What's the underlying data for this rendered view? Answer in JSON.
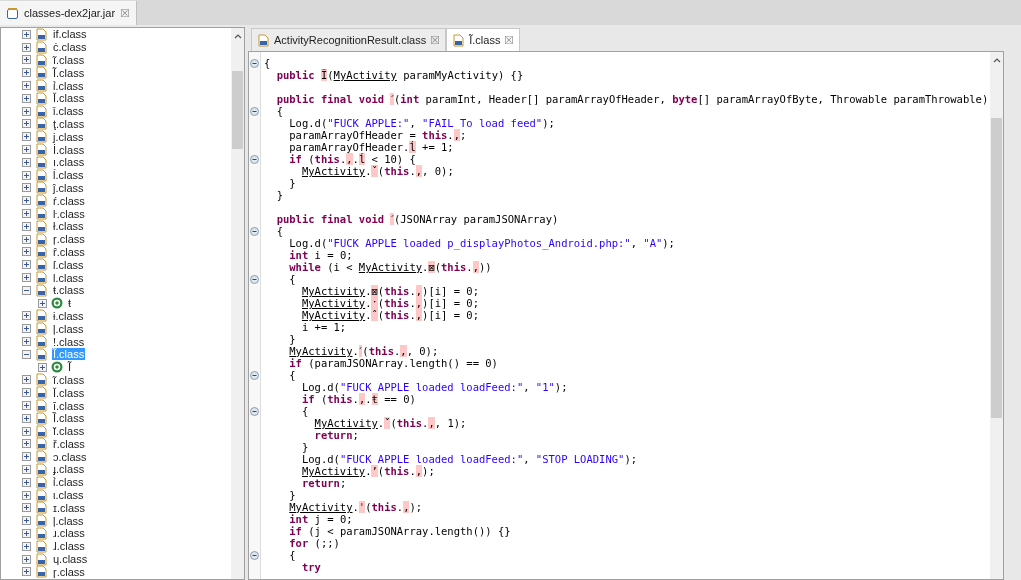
{
  "top_tab": {
    "label": "classes-dex2jar.jar",
    "close": "☒"
  },
  "tree": [
    {
      "name": "if.class",
      "expanded": false,
      "selected": false
    },
    {
      "name": "ċ.class",
      "expanded": false,
      "selected": false
    },
    {
      "name": "ĩ.class",
      "expanded": false,
      "selected": false
    },
    {
      "name": "Ĩ.class",
      "expanded": false,
      "selected": false
    },
    {
      "name": "ỉ.class",
      "expanded": false,
      "selected": false
    },
    {
      "name": "Ĭ.class",
      "expanded": false,
      "selected": false
    },
    {
      "name": "ǐ.class",
      "expanded": false,
      "selected": false
    },
    {
      "name": "ţ.class",
      "expanded": false,
      "selected": false
    },
    {
      "name": "j.class",
      "expanded": false,
      "selected": false
    },
    {
      "name": "İ.class",
      "expanded": false,
      "selected": false
    },
    {
      "name": "ı.class",
      "expanded": false,
      "selected": false
    },
    {
      "name": "ĺ.class",
      "expanded": false,
      "selected": false
    },
    {
      "name": "ĵ.class",
      "expanded": false,
      "selected": false
    },
    {
      "name": "ŕ.class",
      "expanded": false,
      "selected": false
    },
    {
      "name": "ŀ.class",
      "expanded": false,
      "selected": false
    },
    {
      "name": "ł.class",
      "expanded": false,
      "selected": false
    },
    {
      "name": "ŗ.class",
      "expanded": false,
      "selected": false
    },
    {
      "name": "ȓ.class",
      "expanded": false,
      "selected": false
    },
    {
      "name": "ſ.class",
      "expanded": false,
      "selected": false
    },
    {
      "name": "l.class",
      "expanded": false,
      "selected": false
    },
    {
      "name": "ŧ.class",
      "expanded": true,
      "selected": false,
      "children": [
        {
          "name": "ŧ",
          "expanded": false,
          "selected": false
        }
      ]
    },
    {
      "name": "ɨ.class",
      "expanded": false,
      "selected": false
    },
    {
      "name": "ļ.class",
      "expanded": false,
      "selected": false
    },
    {
      "name": "ǃ.class",
      "expanded": false,
      "selected": false
    },
    {
      "name": "Ĩ.class",
      "expanded": true,
      "selected": true,
      "children": [
        {
          "name": "Ĩ",
          "expanded": false,
          "selected": false
        }
      ]
    },
    {
      "name": "ĩ.class",
      "expanded": false,
      "selected": false
    },
    {
      "name": "Ĭ.class",
      "expanded": false,
      "selected": false
    },
    {
      "name": "ī.class",
      "expanded": false,
      "selected": false
    },
    {
      "name": "Ȉ.class",
      "expanded": false,
      "selected": false
    },
    {
      "name": "ĭ.class",
      "expanded": false,
      "selected": false
    },
    {
      "name": "ř.class",
      "expanded": false,
      "selected": false
    },
    {
      "name": "ↄ.class",
      "expanded": false,
      "selected": false
    },
    {
      "name": "ɟ.class",
      "expanded": false,
      "selected": false
    },
    {
      "name": "ỉ.class",
      "expanded": false,
      "selected": false
    },
    {
      "name": "ι.class",
      "expanded": false,
      "selected": false
    },
    {
      "name": "ɪ.class",
      "expanded": false,
      "selected": false
    },
    {
      "name": "ļ.class",
      "expanded": false,
      "selected": false
    },
    {
      "name": "ɹ.class",
      "expanded": false,
      "selected": false
    },
    {
      "name": "ɺ.class",
      "expanded": false,
      "selected": false
    },
    {
      "name": "ɥ.class",
      "expanded": false,
      "selected": false
    },
    {
      "name": "ɼ.class",
      "expanded": false,
      "selected": false
    }
  ],
  "editor_tabs": [
    {
      "label": "ActivityRecognitionResult.class",
      "close": "☒",
      "selected": false
    },
    {
      "label": "Ĩ.class",
      "close": "☒",
      "selected": true
    }
  ],
  "code_lines": [
    {
      "kind": "code",
      "foldable": true,
      "segments": [
        {
          "kind": "plain",
          "text": "{"
        }
      ]
    },
    {
      "kind": "code",
      "foldable": false,
      "segments": [
        {
          "kind": "kw",
          "text": "  public "
        },
        {
          "kind": "hl",
          "text": "Ĩ"
        },
        {
          "kind": "plain",
          "text": "("
        },
        {
          "kind": "link",
          "text": "MyActivity"
        },
        {
          "kind": "plain",
          "text": " paramMyActivity) {}"
        }
      ]
    },
    {
      "kind": "blank"
    },
    {
      "kind": "code",
      "foldable": false,
      "segments": [
        {
          "kind": "kw",
          "text": "  public final void "
        },
        {
          "kind": "hl",
          "text": "ˊ"
        },
        {
          "kind": "plain",
          "text": "("
        },
        {
          "kind": "kw",
          "text": "int"
        },
        {
          "kind": "plain",
          "text": " paramInt, Header[] paramArrayOfHeader, "
        },
        {
          "kind": "kw",
          "text": "byte"
        },
        {
          "kind": "plain",
          "text": "[] paramArrayOfByte, Throwable paramThrowable)"
        }
      ]
    },
    {
      "kind": "code",
      "foldable": true,
      "segments": [
        {
          "kind": "plain",
          "text": "  {"
        }
      ]
    },
    {
      "kind": "code",
      "foldable": false,
      "segments": [
        {
          "kind": "plain",
          "text": "    Log.d("
        },
        {
          "kind": "str",
          "text": "\"FUCK APPLE:\""
        },
        {
          "kind": "plain",
          "text": ", "
        },
        {
          "kind": "str",
          "text": "\"FAIL To load feed\""
        },
        {
          "kind": "plain",
          "text": ");"
        }
      ]
    },
    {
      "kind": "code",
      "foldable": false,
      "segments": [
        {
          "kind": "plain",
          "text": "    paramArrayOfHeader = "
        },
        {
          "kind": "kw",
          "text": "this"
        },
        {
          "kind": "plain",
          "text": "."
        },
        {
          "kind": "hl",
          "text": "‚"
        },
        {
          "kind": "plain",
          "text": ";"
        }
      ]
    },
    {
      "kind": "code",
      "foldable": false,
      "segments": [
        {
          "kind": "plain",
          "text": "    paramArrayOfHeader."
        },
        {
          "kind": "hl",
          "text": "ĺ"
        },
        {
          "kind": "plain",
          "text": " += 1;"
        }
      ]
    },
    {
      "kind": "code",
      "foldable": true,
      "segments": [
        {
          "kind": "kw",
          "text": "    if"
        },
        {
          "kind": "plain",
          "text": " ("
        },
        {
          "kind": "kw",
          "text": "this"
        },
        {
          "kind": "plain",
          "text": "."
        },
        {
          "kind": "hl",
          "text": "‚"
        },
        {
          "kind": "plain",
          "text": "."
        },
        {
          "kind": "hl",
          "text": "ĺ"
        },
        {
          "kind": "plain",
          "text": " < 10) {"
        }
      ]
    },
    {
      "kind": "code",
      "foldable": false,
      "segments": [
        {
          "kind": "link",
          "text": "      MyActivity"
        },
        {
          "kind": "plain",
          "text": "."
        },
        {
          "kind": "hl",
          "text": "ˇ"
        },
        {
          "kind": "plain",
          "text": "("
        },
        {
          "kind": "kw",
          "text": "this"
        },
        {
          "kind": "plain",
          "text": "."
        },
        {
          "kind": "hl",
          "text": "‚"
        },
        {
          "kind": "plain",
          "text": ", 0);"
        }
      ]
    },
    {
      "kind": "code",
      "foldable": false,
      "segments": [
        {
          "kind": "plain",
          "text": "    }"
        }
      ]
    },
    {
      "kind": "code",
      "foldable": false,
      "segments": [
        {
          "kind": "plain",
          "text": "  }"
        }
      ]
    },
    {
      "kind": "blank"
    },
    {
      "kind": "code",
      "foldable": false,
      "segments": [
        {
          "kind": "kw",
          "text": "  public final void "
        },
        {
          "kind": "hl",
          "text": "ˊ"
        },
        {
          "kind": "plain",
          "text": "(JSONArray paramJSONArray)"
        }
      ]
    },
    {
      "kind": "code",
      "foldable": true,
      "segments": [
        {
          "kind": "plain",
          "text": "  {"
        }
      ]
    },
    {
      "kind": "code",
      "foldable": false,
      "segments": [
        {
          "kind": "plain",
          "text": "    Log.d("
        },
        {
          "kind": "str",
          "text": "\"FUCK APPLE loaded p_displayPhotos_Android.php:\""
        },
        {
          "kind": "plain",
          "text": ", "
        },
        {
          "kind": "str",
          "text": "\"A\""
        },
        {
          "kind": "plain",
          "text": ");"
        }
      ]
    },
    {
      "kind": "code",
      "foldable": false,
      "segments": [
        {
          "kind": "kw",
          "text": "    int"
        },
        {
          "kind": "plain",
          "text": " i = 0;"
        }
      ]
    },
    {
      "kind": "code",
      "foldable": false,
      "segments": [
        {
          "kind": "kw",
          "text": "    while"
        },
        {
          "kind": "plain",
          "text": " (i < "
        },
        {
          "kind": "link",
          "text": "MyActivity"
        },
        {
          "kind": "plain",
          "text": "."
        },
        {
          "kind": "hl",
          "text": "⊠"
        },
        {
          "kind": "plain",
          "text": "("
        },
        {
          "kind": "kw",
          "text": "this"
        },
        {
          "kind": "plain",
          "text": "."
        },
        {
          "kind": "hl",
          "text": "‚"
        },
        {
          "kind": "plain",
          "text": "))"
        }
      ]
    },
    {
      "kind": "code",
      "foldable": true,
      "segments": [
        {
          "kind": "plain",
          "text": "    {"
        }
      ]
    },
    {
      "kind": "code",
      "foldable": false,
      "segments": [
        {
          "kind": "link",
          "text": "      MyActivity"
        },
        {
          "kind": "plain",
          "text": "."
        },
        {
          "kind": "hl",
          "text": "⊠"
        },
        {
          "kind": "plain",
          "text": "("
        },
        {
          "kind": "kw",
          "text": "this"
        },
        {
          "kind": "plain",
          "text": "."
        },
        {
          "kind": "hl",
          "text": "‚"
        },
        {
          "kind": "plain",
          "text": ")[i] = 0;"
        }
      ]
    },
    {
      "kind": "code",
      "foldable": false,
      "segments": [
        {
          "kind": "link",
          "text": "      MyActivity"
        },
        {
          "kind": "plain",
          "text": "."
        },
        {
          "kind": "hl",
          "text": "ˑ"
        },
        {
          "kind": "plain",
          "text": "("
        },
        {
          "kind": "kw",
          "text": "this"
        },
        {
          "kind": "plain",
          "text": "."
        },
        {
          "kind": "hl",
          "text": "‚"
        },
        {
          "kind": "plain",
          "text": ")[i] = 0;"
        }
      ]
    },
    {
      "kind": "code",
      "foldable": false,
      "segments": [
        {
          "kind": "link",
          "text": "      MyActivity"
        },
        {
          "kind": "plain",
          "text": "."
        },
        {
          "kind": "hl",
          "text": "ˆ"
        },
        {
          "kind": "plain",
          "text": "("
        },
        {
          "kind": "kw",
          "text": "this"
        },
        {
          "kind": "plain",
          "text": "."
        },
        {
          "kind": "hl",
          "text": "‚"
        },
        {
          "kind": "plain",
          "text": ")[i] = 0;"
        }
      ]
    },
    {
      "kind": "code",
      "foldable": false,
      "segments": [
        {
          "kind": "plain",
          "text": "      i += 1;"
        }
      ]
    },
    {
      "kind": "code",
      "foldable": false,
      "segments": [
        {
          "kind": "plain",
          "text": "    }"
        }
      ]
    },
    {
      "kind": "code",
      "foldable": false,
      "segments": [
        {
          "kind": "link",
          "text": "    MyActivity"
        },
        {
          "kind": "plain",
          "text": "."
        },
        {
          "kind": "hl",
          "text": "ˊ"
        },
        {
          "kind": "plain",
          "text": "("
        },
        {
          "kind": "kw",
          "text": "this"
        },
        {
          "kind": "plain",
          "text": "."
        },
        {
          "kind": "hl",
          "text": "‚"
        },
        {
          "kind": "plain",
          "text": ", 0);"
        }
      ]
    },
    {
      "kind": "code",
      "foldable": false,
      "segments": [
        {
          "kind": "kw",
          "text": "    if"
        },
        {
          "kind": "plain",
          "text": " (paramJSONArray.length() == 0)"
        }
      ]
    },
    {
      "kind": "code",
      "foldable": true,
      "segments": [
        {
          "kind": "plain",
          "text": "    {"
        }
      ]
    },
    {
      "kind": "code",
      "foldable": false,
      "segments": [
        {
          "kind": "plain",
          "text": "      Log.d("
        },
        {
          "kind": "str",
          "text": "\"FUCK APPLE loaded loadFeed:\""
        },
        {
          "kind": "plain",
          "text": ", "
        },
        {
          "kind": "str",
          "text": "\"1\""
        },
        {
          "kind": "plain",
          "text": ");"
        }
      ]
    },
    {
      "kind": "code",
      "foldable": false,
      "segments": [
        {
          "kind": "kw",
          "text": "      if"
        },
        {
          "kind": "plain",
          "text": " ("
        },
        {
          "kind": "kw",
          "text": "this"
        },
        {
          "kind": "plain",
          "text": "."
        },
        {
          "kind": "hl",
          "text": "‚"
        },
        {
          "kind": "plain",
          "text": "."
        },
        {
          "kind": "hl",
          "text": "ŧ"
        },
        {
          "kind": "plain",
          "text": " == 0)"
        }
      ]
    },
    {
      "kind": "code",
      "foldable": true,
      "segments": [
        {
          "kind": "plain",
          "text": "      {"
        }
      ]
    },
    {
      "kind": "code",
      "foldable": false,
      "segments": [
        {
          "kind": "link",
          "text": "        MyActivity"
        },
        {
          "kind": "plain",
          "text": "."
        },
        {
          "kind": "hl",
          "text": "ˇ"
        },
        {
          "kind": "plain",
          "text": "("
        },
        {
          "kind": "kw",
          "text": "this"
        },
        {
          "kind": "plain",
          "text": "."
        },
        {
          "kind": "hl",
          "text": "‚"
        },
        {
          "kind": "plain",
          "text": ", 1);"
        }
      ]
    },
    {
      "kind": "code",
      "foldable": false,
      "segments": [
        {
          "kind": "kw",
          "text": "        return"
        },
        {
          "kind": "plain",
          "text": ";"
        }
      ]
    },
    {
      "kind": "code",
      "foldable": false,
      "segments": [
        {
          "kind": "plain",
          "text": "      }"
        }
      ]
    },
    {
      "kind": "code",
      "foldable": false,
      "segments": [
        {
          "kind": "plain",
          "text": "      Log.d("
        },
        {
          "kind": "str",
          "text": "\"FUCK APPLE loaded loadFeed:\""
        },
        {
          "kind": "plain",
          "text": ", "
        },
        {
          "kind": "str",
          "text": "\"STOP LOADING\""
        },
        {
          "kind": "plain",
          "text": ");"
        }
      ]
    },
    {
      "kind": "code",
      "foldable": false,
      "segments": [
        {
          "kind": "link",
          "text": "      MyActivity"
        },
        {
          "kind": "plain",
          "text": "."
        },
        {
          "kind": "hl",
          "text": "ʼ"
        },
        {
          "kind": "plain",
          "text": "("
        },
        {
          "kind": "kw",
          "text": "this"
        },
        {
          "kind": "plain",
          "text": "."
        },
        {
          "kind": "hl",
          "text": "‚"
        },
        {
          "kind": "plain",
          "text": ");"
        }
      ]
    },
    {
      "kind": "code",
      "foldable": false,
      "segments": [
        {
          "kind": "kw",
          "text": "      return"
        },
        {
          "kind": "plain",
          "text": ";"
        }
      ]
    },
    {
      "kind": "code",
      "foldable": false,
      "segments": [
        {
          "kind": "plain",
          "text": "    }"
        }
      ]
    },
    {
      "kind": "code",
      "foldable": false,
      "segments": [
        {
          "kind": "link",
          "text": "    MyActivity"
        },
        {
          "kind": "plain",
          "text": "."
        },
        {
          "kind": "hl",
          "text": "ˈ"
        },
        {
          "kind": "plain",
          "text": "("
        },
        {
          "kind": "kw",
          "text": "this"
        },
        {
          "kind": "plain",
          "text": "."
        },
        {
          "kind": "hl",
          "text": "‚"
        },
        {
          "kind": "plain",
          "text": ");"
        }
      ]
    },
    {
      "kind": "code",
      "foldable": false,
      "segments": [
        {
          "kind": "kw",
          "text": "    int"
        },
        {
          "kind": "plain",
          "text": " j = 0;"
        }
      ]
    },
    {
      "kind": "code",
      "foldable": false,
      "segments": [
        {
          "kind": "kw",
          "text": "    if"
        },
        {
          "kind": "plain",
          "text": " (j < paramJSONArray.length()) {}"
        }
      ]
    },
    {
      "kind": "code",
      "foldable": false,
      "segments": [
        {
          "kind": "kw",
          "text": "    for"
        },
        {
          "kind": "plain",
          "text": " (;;)"
        }
      ]
    },
    {
      "kind": "code",
      "foldable": true,
      "segments": [
        {
          "kind": "plain",
          "text": "    {"
        }
      ]
    },
    {
      "kind": "code",
      "foldable": false,
      "segments": [
        {
          "kind": "kw",
          "text": "      try"
        }
      ]
    }
  ]
}
